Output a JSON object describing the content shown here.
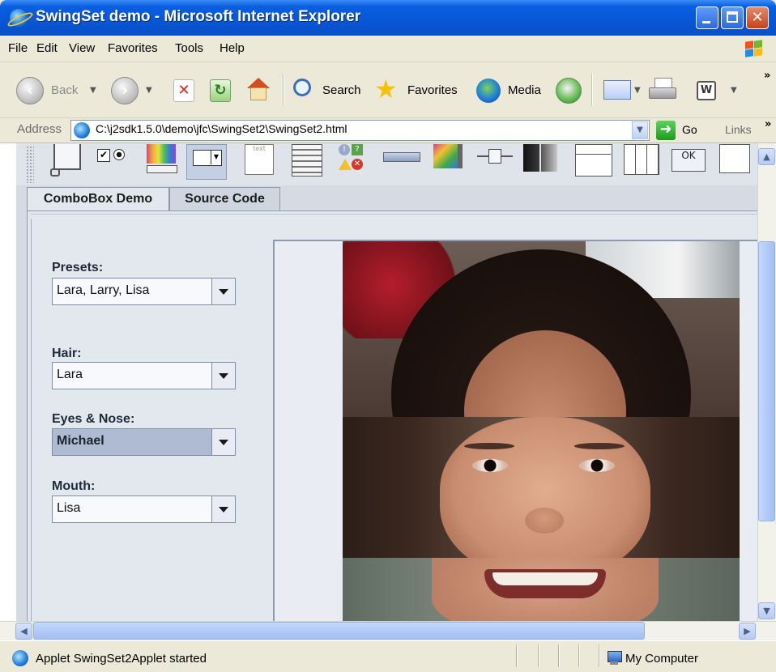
{
  "window": {
    "title": "SwingSet demo - Microsoft Internet Explorer"
  },
  "menu": {
    "items": [
      "File",
      "Edit",
      "View",
      "Favorites",
      "Tools",
      "Help"
    ]
  },
  "toolbar": {
    "back_label": "Back",
    "search_label": "Search",
    "favorites_label": "Favorites",
    "media_label": "Media",
    "overflow": "»"
  },
  "address": {
    "label": "Address",
    "url": "C:\\j2sdk1.5.0\\demo\\jfc\\SwingSet2\\SwingSet2.html",
    "go_label": "Go",
    "links_label": "Links",
    "links_overflow": "»"
  },
  "applet": {
    "tabs": [
      "ComboBox Demo",
      "Source Code"
    ],
    "active_tab": "ComboBox Demo",
    "combos": [
      {
        "label": "Presets:",
        "value": "Lara, Larry, Lisa",
        "selected": false
      },
      {
        "label": "Hair:",
        "value": "Lara",
        "selected": false
      },
      {
        "label": "Eyes & Nose:",
        "value": "Michael",
        "selected": true
      },
      {
        "label": "Mouth:",
        "value": "Lisa",
        "selected": false
      }
    ]
  },
  "status": {
    "text": "Applet SwingSet2Applet started",
    "zone": "My Computer"
  },
  "colors": {
    "titlebar": "#0756d6",
    "chrome": "#ece9d8",
    "swing_panel": "#e3e8ef",
    "combo_selected": "#aebbd2"
  }
}
